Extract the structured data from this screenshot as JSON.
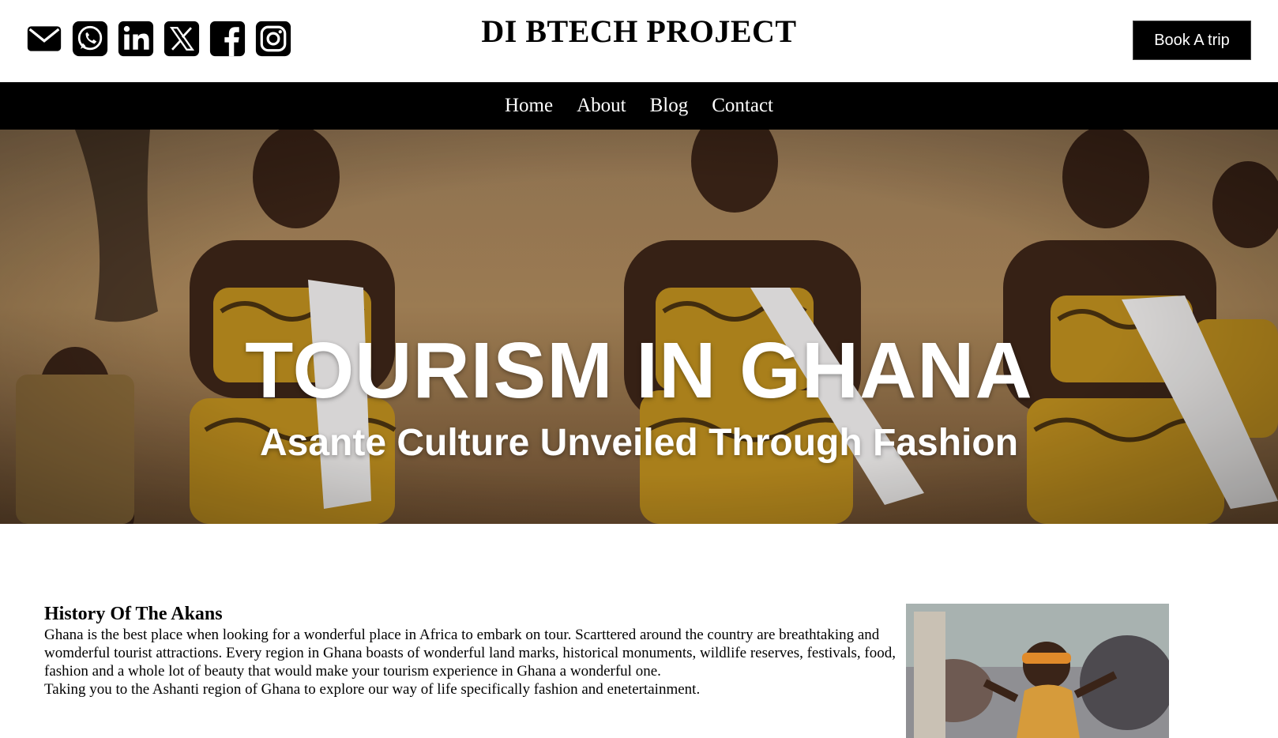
{
  "header": {
    "site_title": "DI BTECH PROJECT",
    "book_label": "Book A trip",
    "social_icons": [
      "mail-icon",
      "whatsapp-icon",
      "linkedin-icon",
      "x-icon",
      "facebook-icon",
      "instagram-icon"
    ]
  },
  "nav": {
    "items": [
      "Home",
      "About",
      "Blog",
      "Contact"
    ]
  },
  "hero": {
    "title": "TOURISM IN GHANA",
    "subtitle": "Asante Culture Unveiled Through Fashion"
  },
  "article": {
    "heading": "History Of The Akans",
    "paragraph_1": "Ghana is the best place when looking for a wonderful place in Africa to embark on tour. Scarttered around the country are breathtaking and womderful tourist attractions. Every region in Ghana boasts of wonderful land marks, historical monuments, wildlife reserves, festivals, food, fashion and a whole lot of beauty that would make your tourism experience in Ghana a wonderful one.",
    "paragraph_2": "Taking you to the Ashanti region of Ghana to explore our way of life specifically fashion and enetertainment."
  },
  "colors": {
    "header_bg": "#ffffff",
    "nav_bg": "#000000",
    "button_bg": "#000000",
    "text": "#000000"
  }
}
